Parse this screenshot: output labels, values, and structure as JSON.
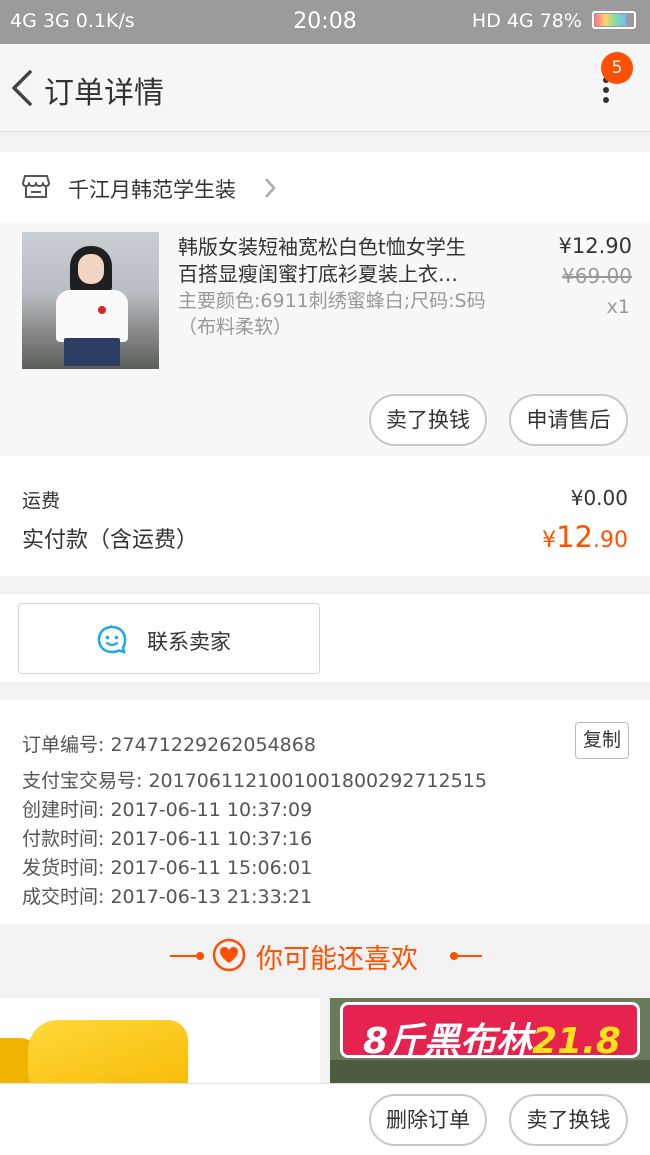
{
  "status_bar": {
    "left": "4G 3G 0.1K/s",
    "time": "20:08",
    "right": "HD 4G 78%"
  },
  "nav": {
    "title": "订单详情",
    "badge": "5"
  },
  "shop": {
    "name": "千江月韩范学生装"
  },
  "product": {
    "title_line1": "韩版女装短袖宽松白色t恤女学生",
    "title_line2": "百搭显瘦闺蜜打底衫夏装上衣…",
    "sku": "主要颜色:6911刺绣蜜蜂白;尺码:S码（布料柔软）",
    "price": "¥12.90",
    "original_price": "¥69.00",
    "quantity": "x1",
    "btn_sell": "卖了换钱",
    "btn_aftersale": "申请售后"
  },
  "payment": {
    "shipping_label": "运费",
    "shipping_value": "¥0.00",
    "total_label": "实付款（含运费）",
    "total_symbol": "¥",
    "total_int": "12",
    "total_dec": ".90"
  },
  "contact": {
    "label": "联系卖家"
  },
  "order_info": {
    "order_no": "订单编号: 2747122926205486​8",
    "alipay_no": "支付宝交易号: 2017061121001001800292712515",
    "created": "创建时间: 2017-06-11 10:37:09",
    "paid": "付款时间: 2017-06-11 10:37:16",
    "shipped": "发货时间: 2017-06-11 15:06:01",
    "completed": "成交时间: 2017-06-13 21:33:21",
    "copy_label": "复制"
  },
  "recommend": {
    "title": "你可能还喜欢",
    "promo_a": "8斤黑布林",
    "promo_b": "21.8"
  },
  "bottom_bar": {
    "delete_label": "删除订单",
    "sell_label": "卖了换钱"
  },
  "colors": {
    "accent": "#ff5000",
    "status_bar": "#9b9b9b"
  }
}
